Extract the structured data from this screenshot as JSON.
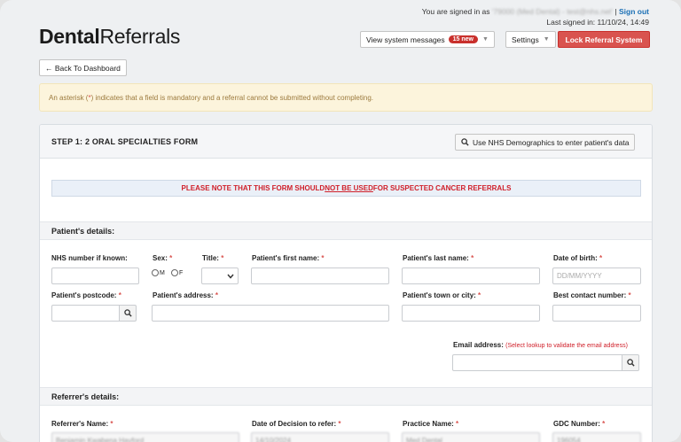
{
  "header": {
    "signed_in_prefix": "You are signed in as",
    "account": "'79000 (Med Dental) - test@nhs.net'",
    "separator": "|",
    "sign_out": "Sign out",
    "last_signed": "Last signed in: 11/10/24, 14:49",
    "logo_bold": "Dental",
    "logo_regular": "Referrals"
  },
  "toolbar": {
    "messages_label": "View system messages",
    "messages_badge": "15 new",
    "settings_label": "Settings",
    "lock_label": "Lock Referral System",
    "back_label": "← Back To Dashboard"
  },
  "alert": {
    "before": "An asterisk (",
    "star": "*",
    "after": ") indicates that a field is mandatory and a referral cannot be submitted without completing."
  },
  "form": {
    "title": "STEP 1: 2 ORAL SPECIALTIES FORM",
    "demographics_button": "Use NHS Demographics to enter patient's data",
    "notice_before": "PLEASE NOTE THAT THIS FORM SHOULD ",
    "notice_emph": "NOT BE USED",
    "notice_after": " FOR SUSPECTED CANCER REFERRALS"
  },
  "patient": {
    "heading": "Patient's details:",
    "nhs_label": "NHS number if known:",
    "sex_label": "Sex:",
    "sex_m": "M",
    "sex_f": "F",
    "title_label": "Title:",
    "first_name_label": "Patient's first name:",
    "last_name_label": "Patient's last name:",
    "dob_label": "Date of birth:",
    "dob_placeholder": "DD/MM/YYYY",
    "postcode_label": "Patient's postcode:",
    "address_label": "Patient's address:",
    "town_label": "Patient's town or city:",
    "contact_label": "Best contact number:",
    "email_label": "Email address:",
    "email_hint": "(Select lookup to validate the email address)",
    "asterisk": "*"
  },
  "referrer": {
    "heading": "Referrer's details:",
    "name_label": "Referrer's Name:",
    "name_value": "Benjamin Kwabena Hayford",
    "decision_label": "Date of Decision to refer:",
    "decision_value": "14/10/2024",
    "practice_label": "Practice Name:",
    "practice_value": "Med Dental",
    "gdc_label": "GDC Number:",
    "gdc_value": "196054"
  },
  "colors": {
    "danger": "#d9534f",
    "link": "#1a6fb5",
    "alert_bg": "#fcf4dc"
  }
}
